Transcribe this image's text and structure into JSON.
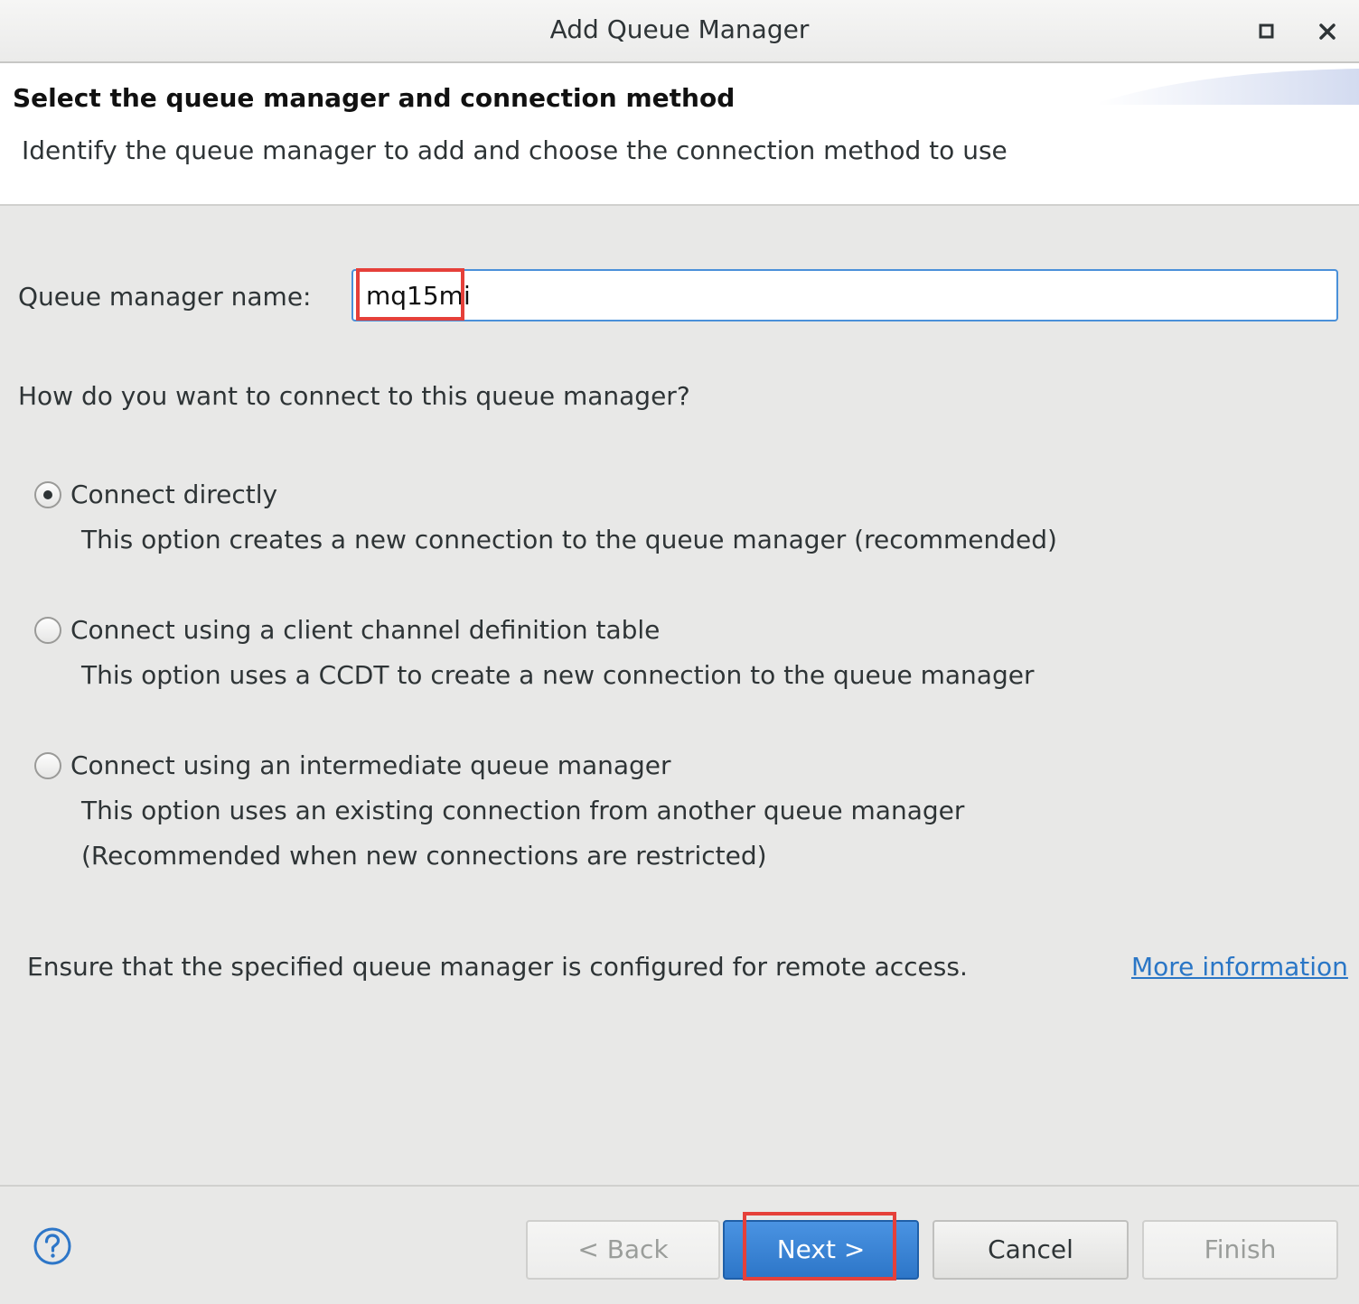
{
  "window": {
    "title": "Add Queue Manager",
    "icons": [
      "maximize-icon",
      "close-icon"
    ]
  },
  "header": {
    "title": "Select the queue manager and connection method",
    "description": "Identify the queue manager to add and choose the connection method to use"
  },
  "form": {
    "qm_name_label": "Queue manager name:",
    "qm_name_value": "mq15mi",
    "question": "How do you want to connect to this queue manager?"
  },
  "options": [
    {
      "label": "Connect directly",
      "desc": [
        "This option creates a new connection to the queue manager (recommended)"
      ],
      "selected": true
    },
    {
      "label": "Connect using a client channel definition table",
      "desc": [
        "This option uses a CCDT to create a new connection to the queue manager"
      ],
      "selected": false
    },
    {
      "label": "Connect using an intermediate queue manager",
      "desc": [
        "This option uses an existing connection from another queue manager",
        "(Recommended when new connections are restricted)"
      ],
      "selected": false
    }
  ],
  "note": "Ensure that the specified queue manager is configured for remote access.",
  "more_info_link": "More information",
  "buttons": {
    "back": "< Back",
    "next": "Next >",
    "cancel": "Cancel",
    "finish": "Finish"
  },
  "colors": {
    "accent": "#2d76c8",
    "highlight": "#e5403a",
    "link": "#2a76c6"
  }
}
